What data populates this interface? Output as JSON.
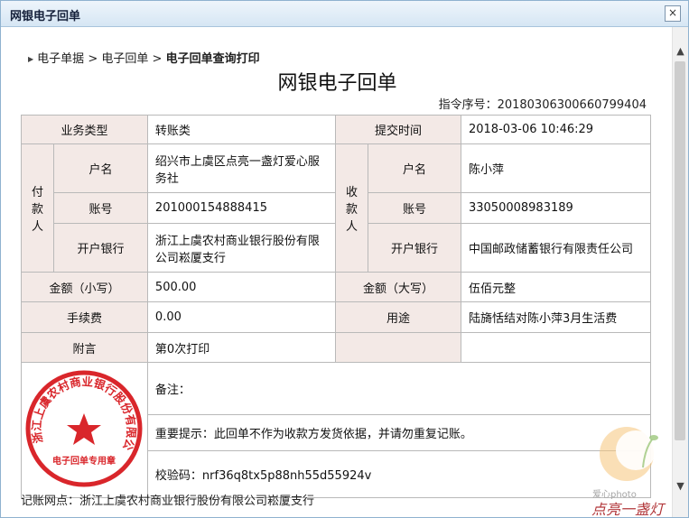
{
  "window": {
    "title": "网银电子回单",
    "close_symbol": "×"
  },
  "breadcrumb": {
    "items": [
      "电子单据",
      "电子回单"
    ],
    "separator": ">",
    "current": "电子回单查询打印"
  },
  "doc_title": "网银电子回单",
  "serial": {
    "label": "指令序号：",
    "value": "20180306300660799404"
  },
  "table": {
    "business_type_label": "业务类型",
    "business_type_value": "转账类",
    "submit_time_label": "提交时间",
    "submit_time_value": "2018-03-06 10:46:29",
    "payer_label": "付款人",
    "payee_label": "收款人",
    "name_label": "户名",
    "account_label": "账号",
    "bank_label": "开户银行",
    "payer": {
      "name": "绍兴市上虞区点亮一盏灯爱心服务社",
      "account": "201000154888415",
      "bank": "浙江上虞农村商业银行股份有限公司崧厦支行"
    },
    "payee": {
      "name": "陈小萍",
      "account": "33050008983189",
      "bank": "中国邮政储蓄银行有限责任公司"
    },
    "amount_small_label": "金额（小写）",
    "amount_small_value": "500.00",
    "amount_big_label": "金额（大写）",
    "amount_big_value": "伍佰元整",
    "fee_label": "手续费",
    "fee_value": "0.00",
    "purpose_label": "用途",
    "purpose_value": "陆旖恬结对陈小萍3月生活费",
    "note_label": "附言",
    "note_value": "第0次打印",
    "remark": "备注：",
    "important": "重要提示：此回单不作为收款方发货依据，并请勿重复记账。",
    "verify_code": "校验码：nrf36q8tx5p88nh55d55924v"
  },
  "seal": {
    "outer_text": "浙江上虞农村商业银行股份有限公司",
    "inner_text": "电子回单专用章",
    "color": "#d9262b"
  },
  "bottom_text": "记账网点：浙江上虞农村商业银行股份有限公司崧厦支行",
  "watermark": {
    "small_text": "爱心photo",
    "text": "点亮一盏灯"
  }
}
